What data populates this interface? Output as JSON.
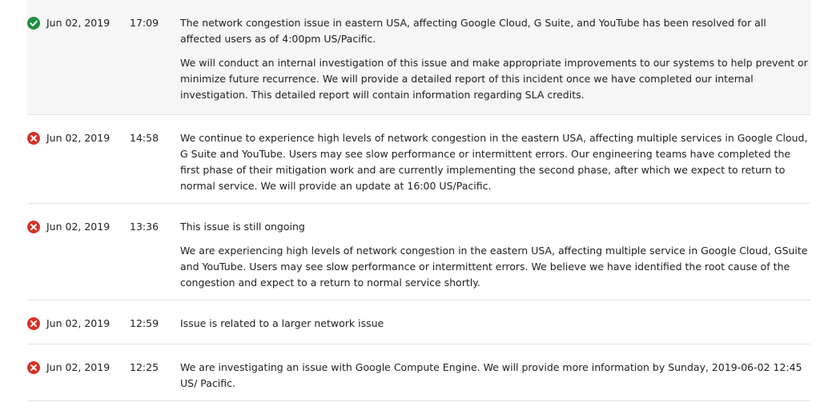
{
  "status_colors": {
    "resolved": "#1e8e3e",
    "outage": "#d93025"
  },
  "incidents": [
    {
      "status_icon": "check-circle-icon",
      "date": "Jun 02, 2019",
      "time": "17:09",
      "paragraphs": [
        "The network congestion issue in eastern USA, affecting Google Cloud, G Suite, and YouTube has been resolved for all affected users as of 4:00pm US/Pacific.",
        "We will conduct an internal investigation of this issue and make appropriate improvements to our systems to help prevent or minimize future recurrence. We will provide a detailed report of this incident once we have completed our internal investigation. This detailed report will contain information regarding SLA credits."
      ]
    },
    {
      "status_icon": "x-circle-icon",
      "date": "Jun 02, 2019",
      "time": "14:58",
      "paragraphs": [
        "We continue to experience high levels of network congestion in the eastern USA, affecting multiple services in Google Cloud, G Suite and YouTube. Users may see slow performance or intermittent errors. Our engineering teams have completed the first phase of their mitigation work and are currently implementing the second phase, after which we expect to return to normal service. We will provide an update at 16:00 US/Pacific."
      ]
    },
    {
      "status_icon": "x-circle-icon",
      "date": "Jun 02, 2019",
      "time": "13:36",
      "paragraphs": [
        "This issue is still ongoing",
        "We are experiencing high levels of network congestion in the eastern USA, affecting multiple service in Google Cloud, GSuite and YouTube. Users may see slow performance or intermittent errors. We believe we have identified the root cause of the congestion and expect to a return to normal service shortly."
      ]
    },
    {
      "status_icon": "x-circle-icon",
      "date": "Jun 02, 2019",
      "time": "12:59",
      "paragraphs": [
        "Issue is related to a larger network issue"
      ]
    },
    {
      "status_icon": "x-circle-icon",
      "date": "Jun 02, 2019",
      "time": "12:25",
      "paragraphs": [
        "We are investigating an issue with Google Compute Engine. We will provide more information by Sunday, 2019-06-02 12:45 US/ Pacific."
      ]
    }
  ]
}
